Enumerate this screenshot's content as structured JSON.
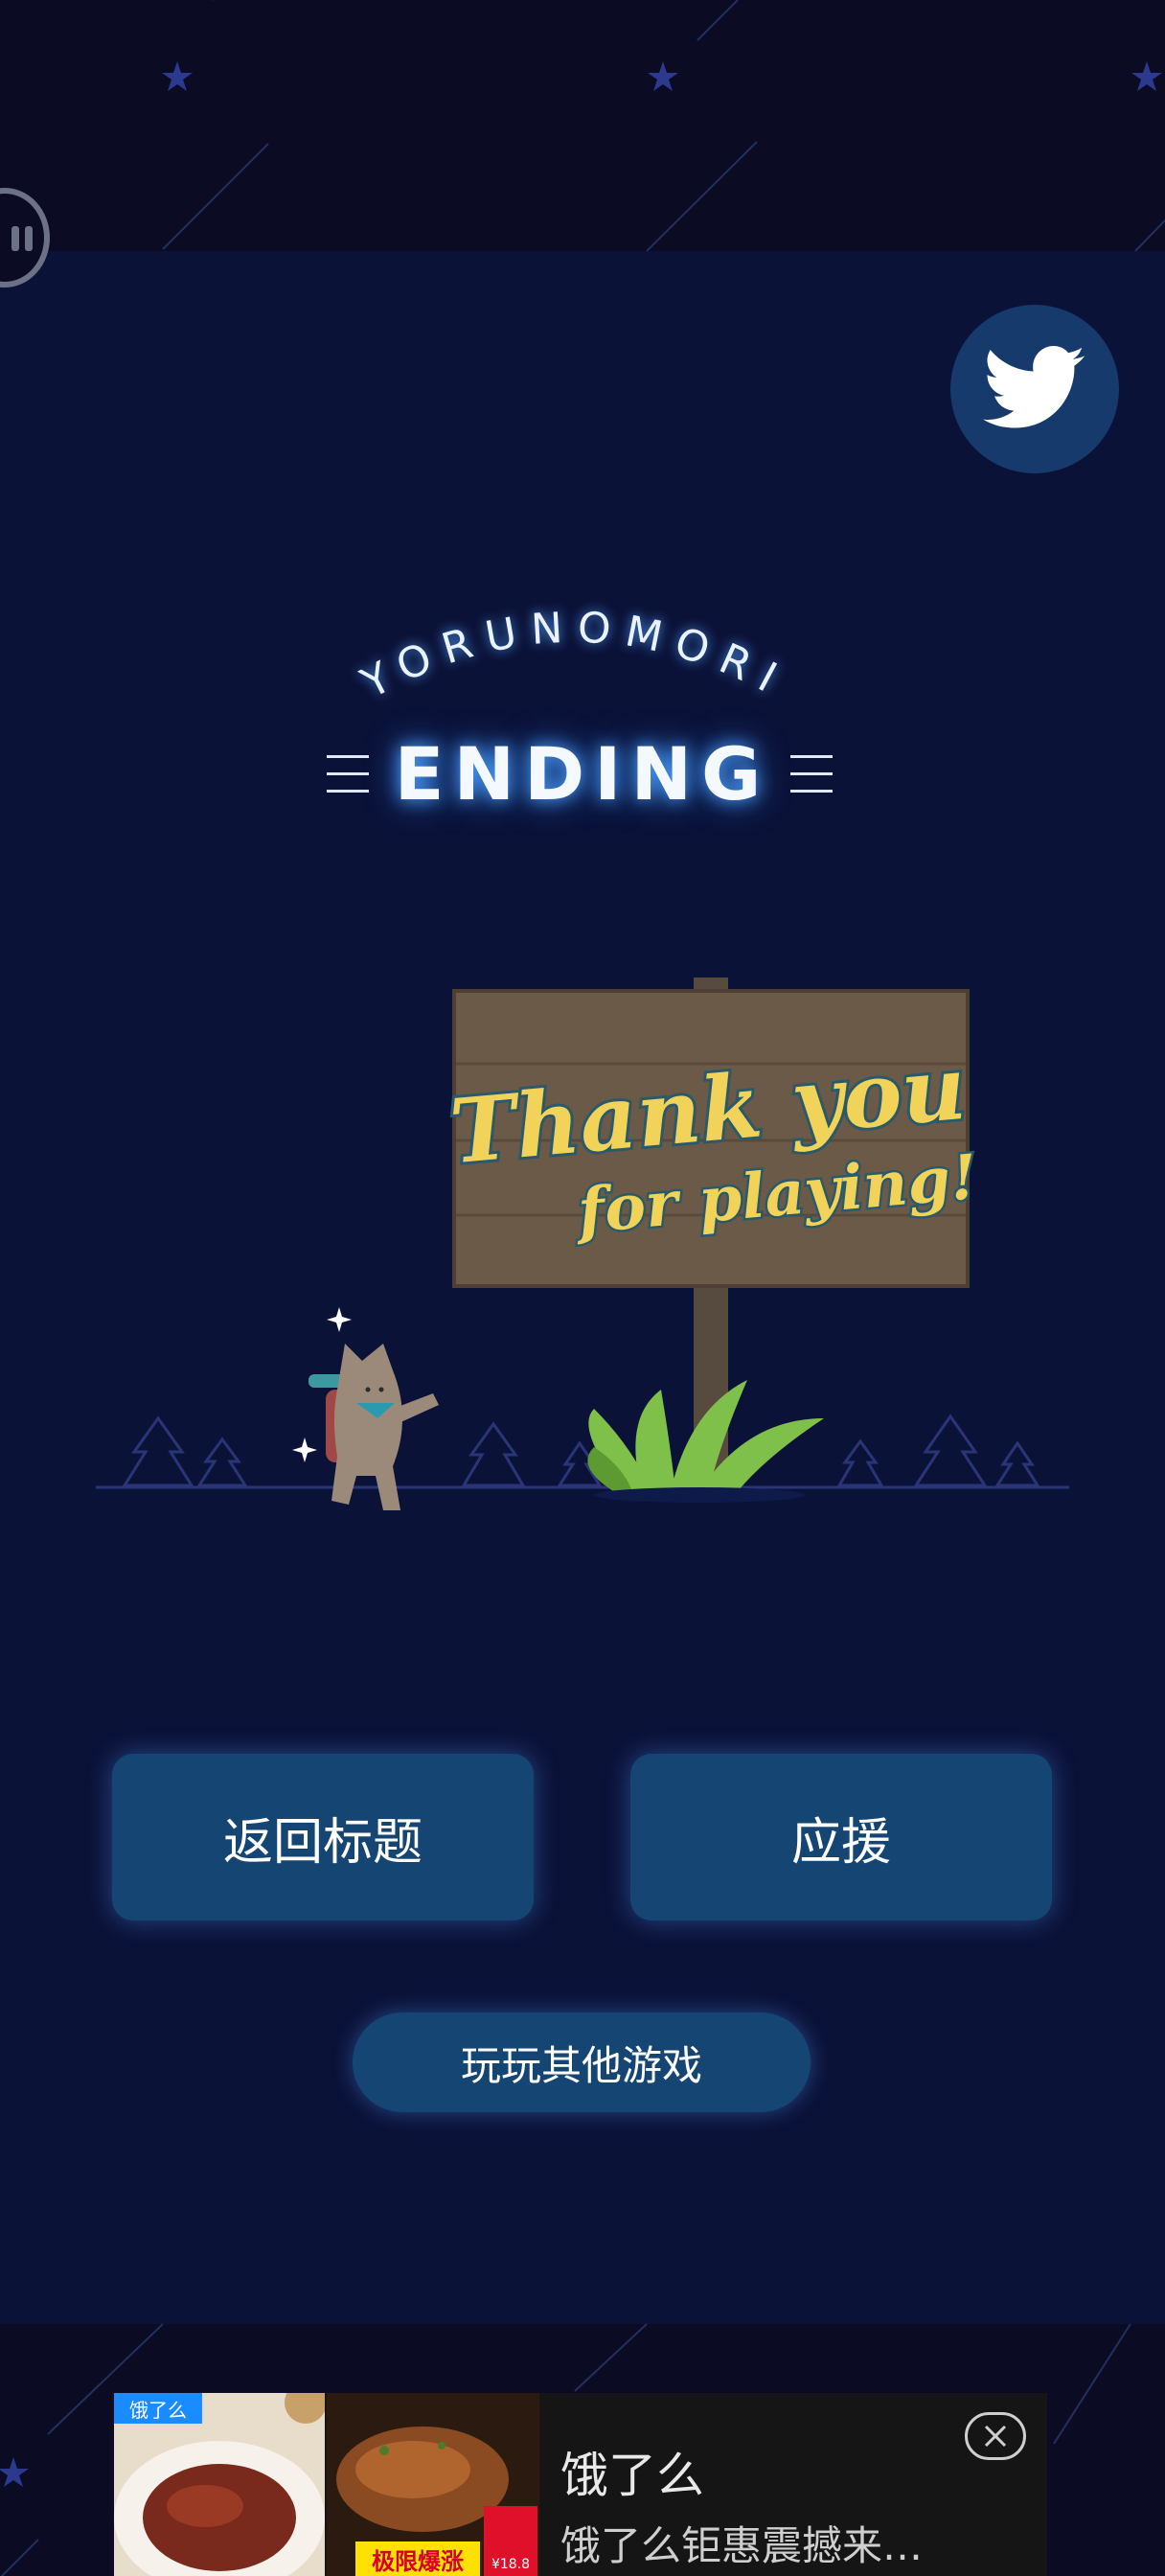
{
  "logo": {
    "arc_text": "YORUNOMORI",
    "title": "ENDING"
  },
  "sign": {
    "line1": "Thank you",
    "line2": "for playing!"
  },
  "buttons": {
    "back_to_title": "返回标题",
    "support": "应援",
    "play_other_games": "玩玩其他游戏"
  },
  "ad": {
    "brand_badge": "饿了么",
    "promo_tag": "极限爆涨",
    "price_tag": "¥18.8",
    "title": "饿了么",
    "subtitle": "饿了么钜惠震撼来…"
  },
  "icons": {
    "twitter": "twitter-bird-icon",
    "pause": "pause-icon",
    "close": "close-icon"
  },
  "colors": {
    "background": "#0b1238",
    "button": "#154572",
    "sign_text": "#f2d35a"
  }
}
